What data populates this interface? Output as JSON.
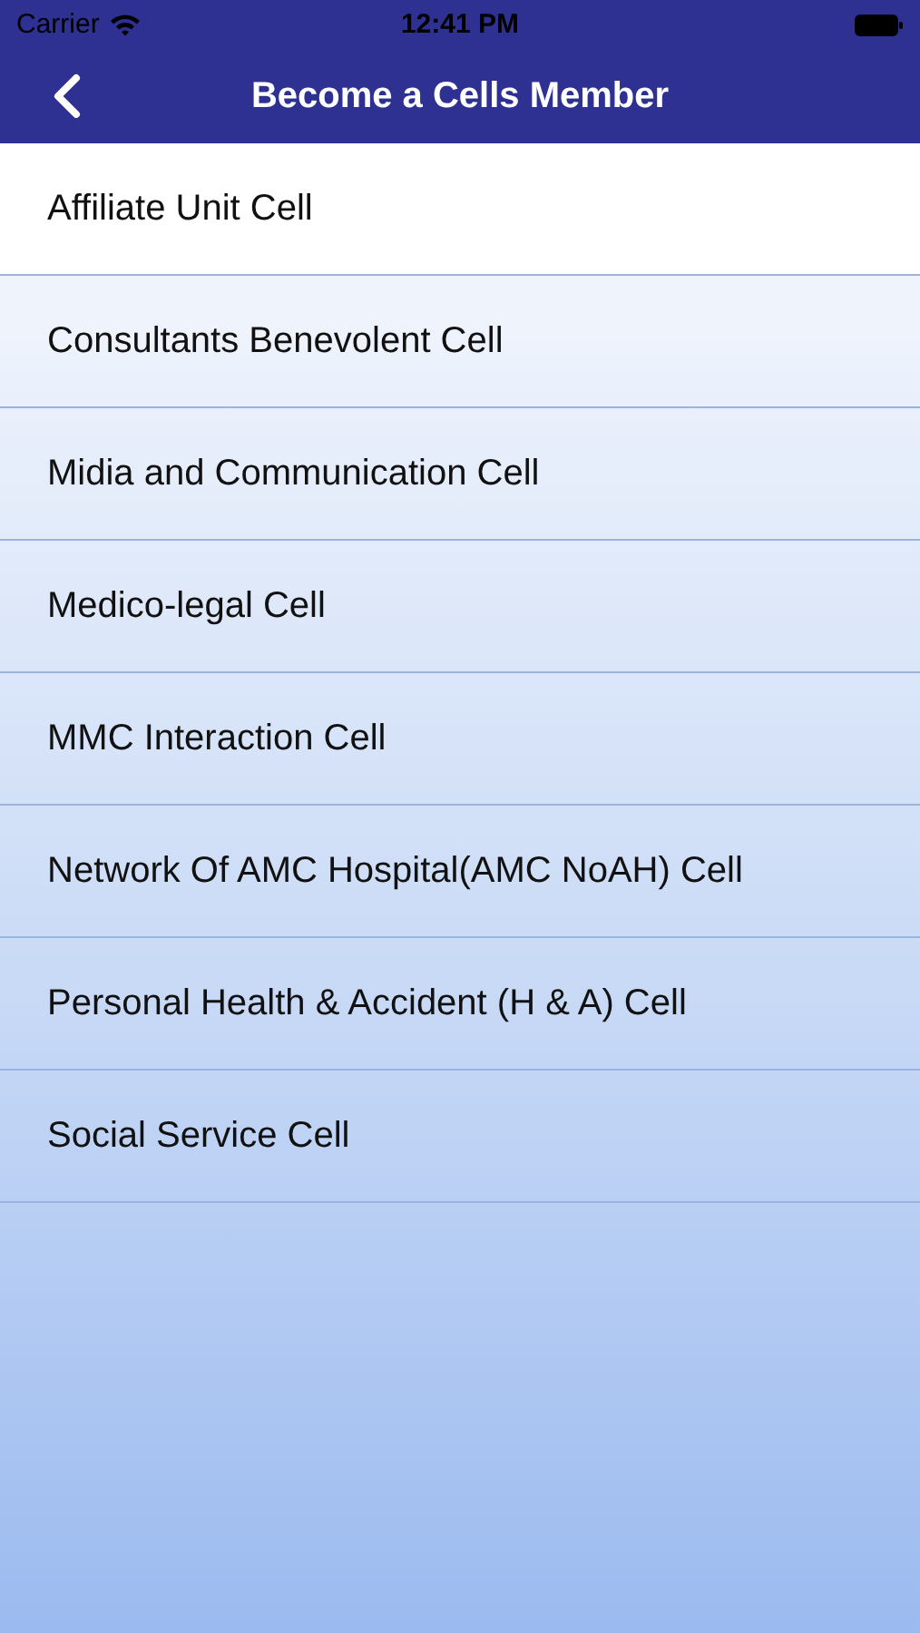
{
  "status_bar": {
    "carrier": "Carrier",
    "time": "12:41 PM"
  },
  "nav_bar": {
    "title": "Become a Cells Member"
  },
  "cells": [
    {
      "label": "Affiliate Unit Cell",
      "selected": true
    },
    {
      "label": "Consultants Benevolent Cell",
      "selected": false
    },
    {
      "label": "Midia and Communication Cell",
      "selected": false
    },
    {
      "label": "Medico-legal Cell",
      "selected": false
    },
    {
      "label": "MMC Interaction Cell",
      "selected": false
    },
    {
      "label": "Network Of AMC Hospital(AMC NoAH) Cell",
      "selected": false
    },
    {
      "label": "Personal Health & Accident (H & A) Cell",
      "selected": false
    },
    {
      "label": "Social Service Cell",
      "selected": false
    }
  ]
}
